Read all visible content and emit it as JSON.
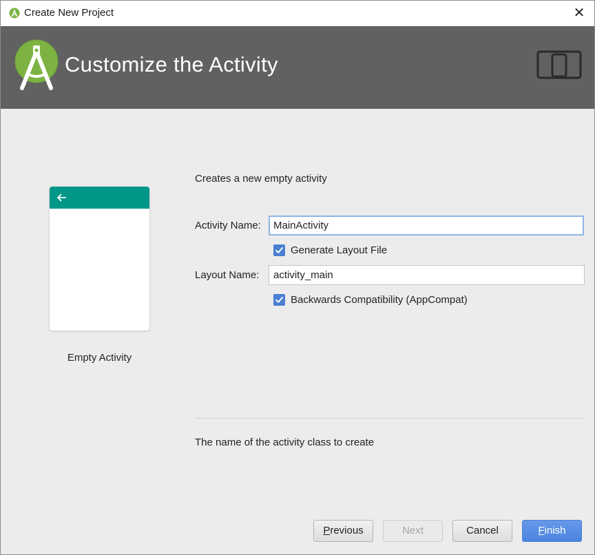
{
  "window": {
    "title": "Create New Project",
    "close_glyph": "✕"
  },
  "banner": {
    "heading": "Customize the Activity",
    "bg_color": "#616161",
    "logo_icon": "android-studio-logo-icon",
    "device_icon": "tablet-phone-devices-icon"
  },
  "preview": {
    "label": "Empty Activity",
    "appbar_color": "#009688",
    "back_icon": "arrow-back-icon"
  },
  "form": {
    "description": "Creates a new empty activity",
    "activity_name": {
      "label": "Activity Name:",
      "value": "MainActivity"
    },
    "generate_layout": {
      "label": "Generate Layout File",
      "checked": true
    },
    "layout_name": {
      "label": "Layout Name:",
      "value": "activity_main"
    },
    "backwards_compat": {
      "label": "Backwards Compatibility (AppCompat)",
      "checked": true
    },
    "help_text": "The name of the activity class to create"
  },
  "buttons": {
    "previous": {
      "mnemonic": "P",
      "rest": "revious"
    },
    "next": "Next",
    "cancel": "Cancel",
    "finish": {
      "mnemonic": "F",
      "rest": "inish"
    }
  },
  "colors": {
    "checkbox": "#4a7ed1",
    "primary_button": "#5a8ee6"
  }
}
